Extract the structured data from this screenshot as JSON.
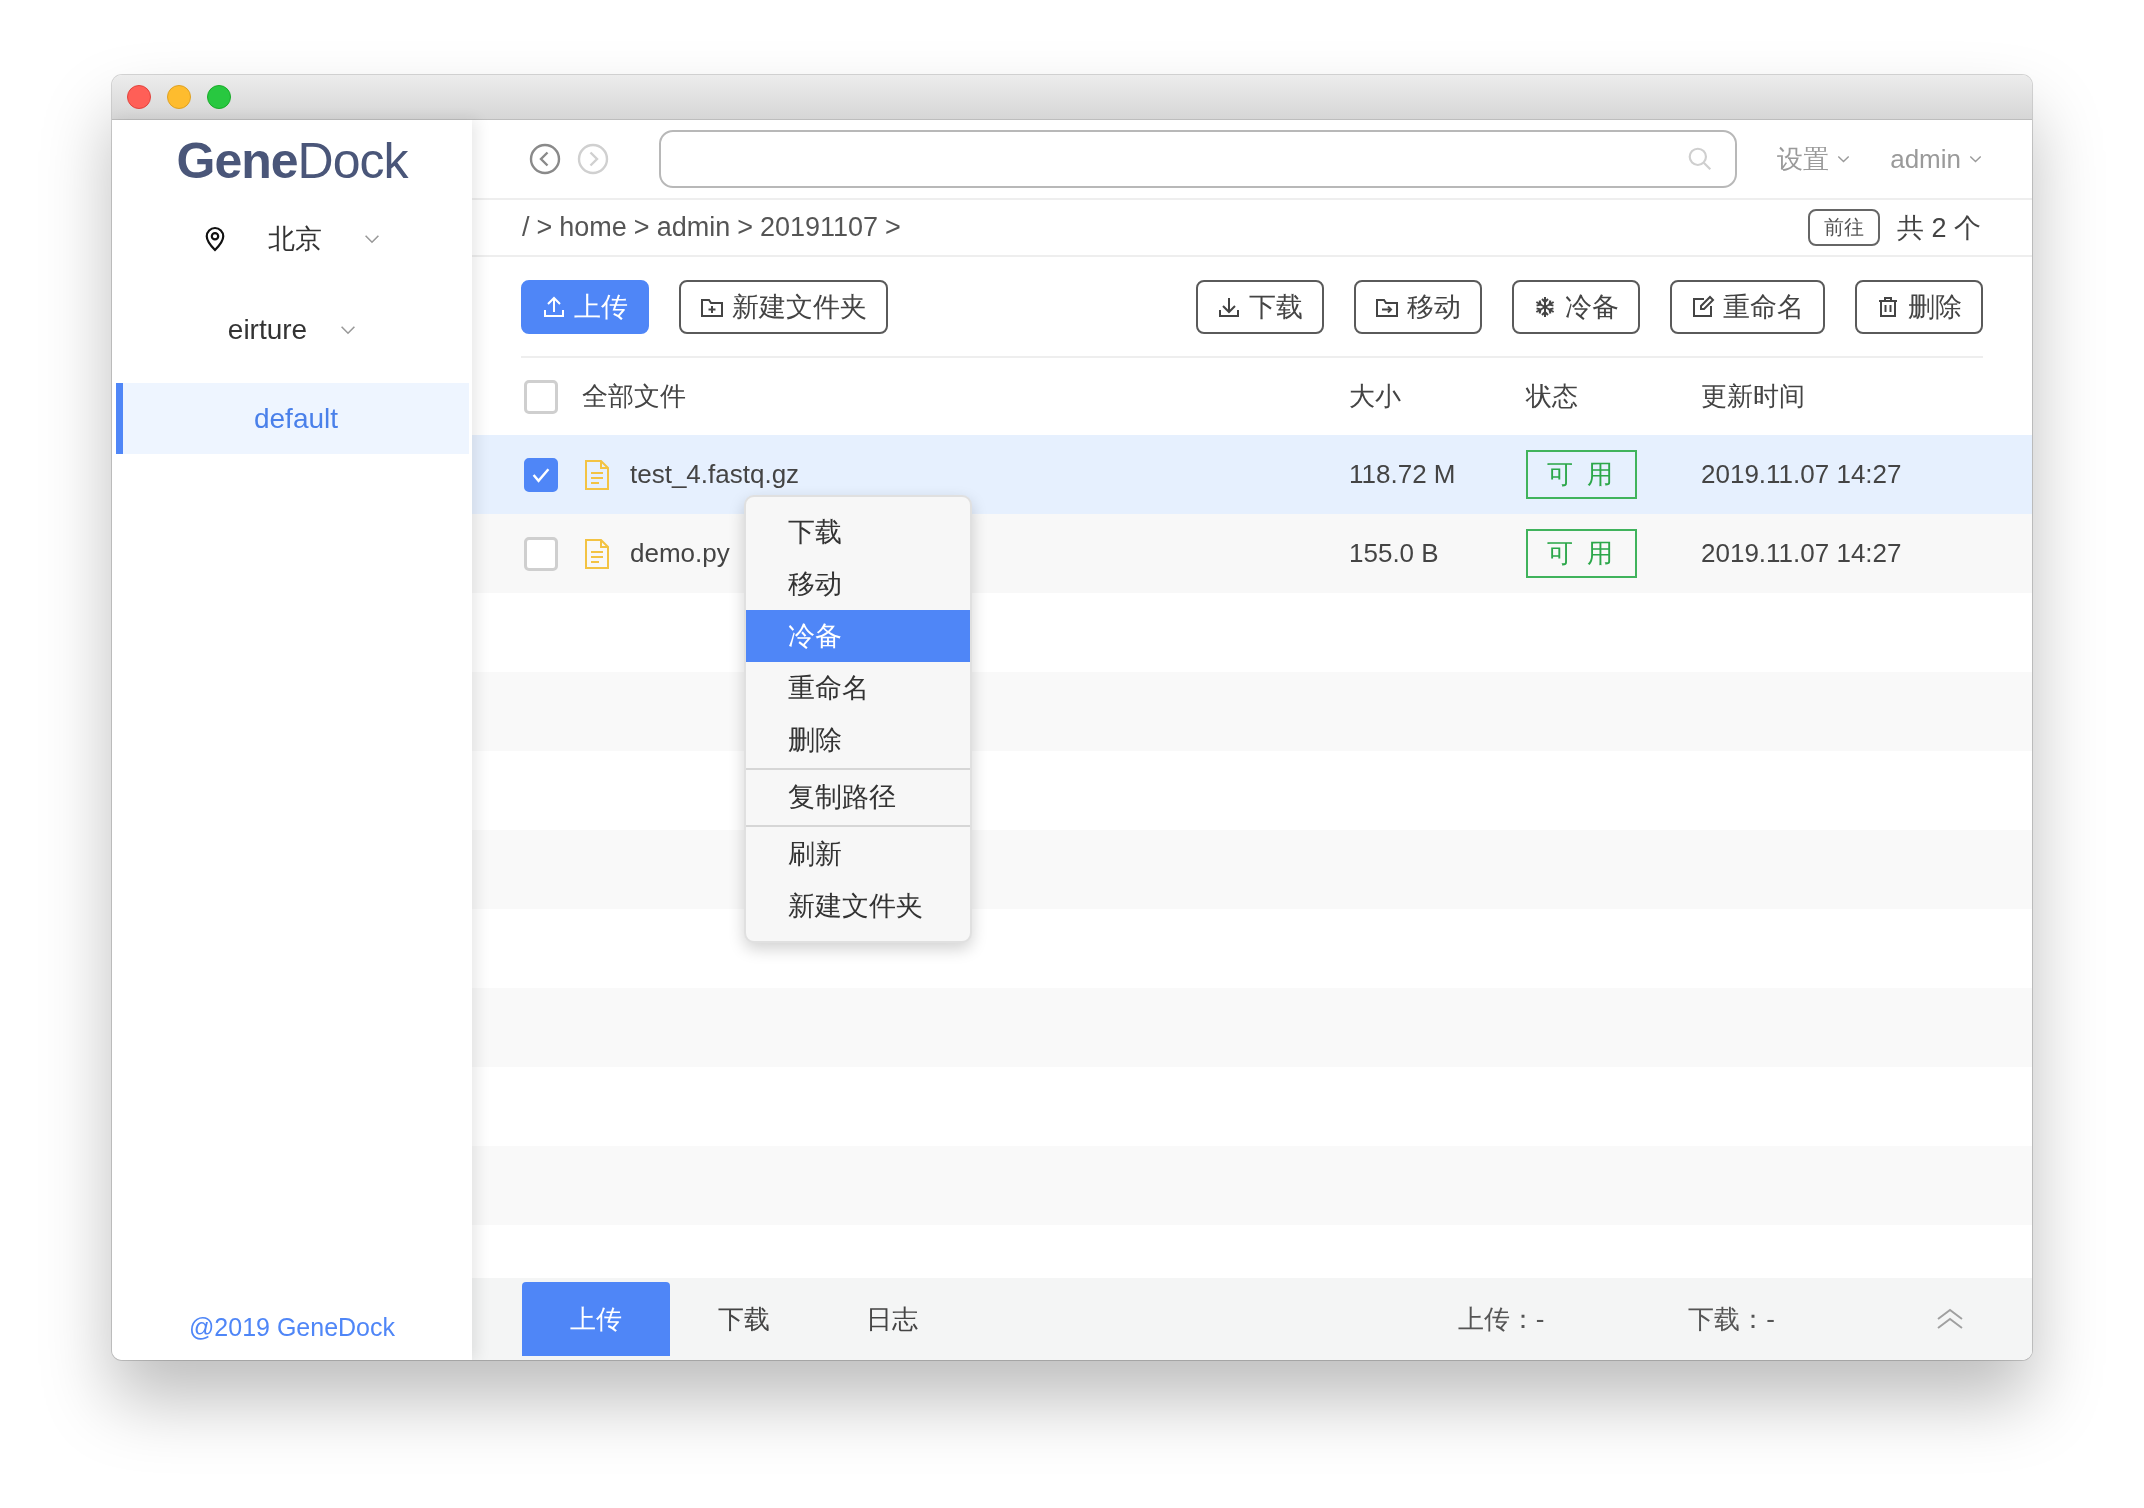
{
  "sidebar": {
    "logo": "**Gene**Dock",
    "region": "北京",
    "account": "eirture",
    "items": [
      {
        "label": "default",
        "selected": true
      }
    ],
    "footer": "@2019 GeneDock"
  },
  "top_bar": {
    "history": [
      {
        "kind": "back",
        "disabled": false
      },
      {
        "kind": "forward",
        "disabled": true
      }
    ],
    "menus": [
      "设置",
      "admin"
    ]
  },
  "breadcrumb": {
    "segments": [
      "/",
      "home",
      "admin",
      "20191107"
    ],
    "separator": ">",
    "go_button": "前往",
    "count": "共 2 个"
  },
  "toolbar": {
    "left": [
      {
        "kind": "upload",
        "label": "上传",
        "primary": true
      },
      {
        "kind": "new-folder",
        "label": "新建文件夹",
        "primary": false
      }
    ],
    "right": [
      {
        "kind": "download",
        "label": "下载",
        "primary": false
      },
      {
        "kind": "move",
        "label": "移动",
        "primary": false
      },
      {
        "kind": "cold-backup",
        "label": "冷备",
        "primary": false
      },
      {
        "kind": "rename",
        "label": "重命名",
        "primary": false
      },
      {
        "kind": "delete",
        "label": "删除",
        "primary": false
      }
    ]
  },
  "table": {
    "select_all": {
      "checked": false
    },
    "columns": [
      "全部文件",
      "大小",
      "状态",
      "更新时间"
    ],
    "rows": [
      {
        "name": "test_4.fastq.gz",
        "size": "118.72 M",
        "status": "可 用",
        "updated": "2019.11.07 14:27",
        "checked": true,
        "selected": true
      },
      {
        "name": "demo.py",
        "size": "155.0 B",
        "status": "可 用",
        "updated": "2019.11.07 14:27",
        "checked": false,
        "selected": false
      }
    ]
  },
  "context_menu": {
    "groups": [
      [
        {
          "label": "下载",
          "selected": false
        },
        {
          "label": "移动",
          "selected": false
        },
        {
          "label": "冷备",
          "selected": true
        },
        {
          "label": "重命名",
          "selected": false
        },
        {
          "label": "删除",
          "selected": false
        }
      ],
      [
        {
          "label": "复制路径",
          "selected": false
        }
      ],
      [
        {
          "label": "刷新",
          "selected": false
        },
        {
          "label": "新建文件夹",
          "selected": false
        }
      ]
    ]
  },
  "transfer_panel": {
    "tabs": [
      {
        "label": "上传",
        "selected": true
      },
      {
        "label": "下载",
        "selected": false
      },
      {
        "label": "日志",
        "selected": false
      }
    ],
    "stats": [
      "上传：-",
      "下载：-"
    ]
  }
}
